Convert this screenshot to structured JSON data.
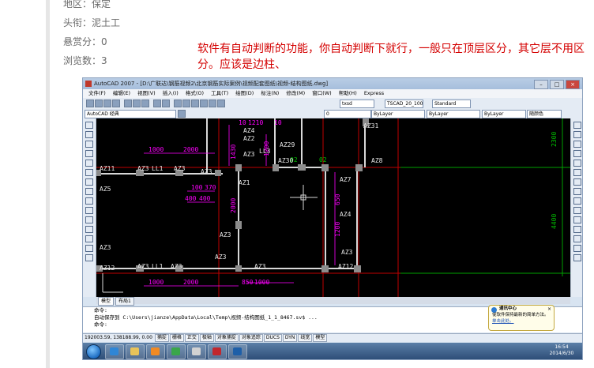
{
  "post": {
    "region": "地区：保定",
    "title_rank": "头衔：泥土工",
    "bounty": "悬赏分：0",
    "views": "浏览数：3"
  },
  "answer_text": "软件有自动判断的功能，你自动判断下就行，一般只在顶层区分，其它层不用区分。应该是边柱、",
  "autocad": {
    "window_title": "AutoCAD 2007 - [D:\\广联达\\钢筋视频2\\北京钢筋实际案例\\视频配套图纸\\视频-结构图纸.dwg]",
    "menu": [
      "文件(F)",
      "编辑(E)",
      "视图(V)",
      "插入(I)",
      "格式(O)",
      "工具(T)",
      "绘图(D)",
      "标注(N)",
      "修改(M)",
      "窗口(W)",
      "帮助(H)",
      "Express"
    ],
    "workspace": "AutoCAD 经典",
    "text_style": "txsd",
    "dim_style": "ISO-25",
    "table_style": "Standard",
    "dim_style2": "TSCAD_20_100",
    "layer": "0",
    "color": "ByLayer",
    "linetype": "ByLayer",
    "lineweight": "ByLayer",
    "plot_style": "随颜色",
    "drawing": {
      "labels": [
        "AZ11",
        "AZ3",
        "LL1",
        "AZ3",
        "AZ3",
        "AZ2",
        "AZ29",
        "AZ30",
        "AZ7",
        "AZ31",
        "AZ8",
        "AZ1",
        "AZ7",
        "AZ4",
        "AZ3",
        "AZ3",
        "AZ12",
        "AZ3",
        "LL1",
        "AZ3",
        "AZ12",
        "AZ4",
        "AZ3",
        "LL3",
        "AZ3",
        "AZ5",
        "AZ3",
        "AZ3"
      ],
      "dims_h": [
        "1000",
        "2000",
        "100",
        "370",
        "400",
        "400",
        "1000",
        "2000",
        "850",
        "1000",
        "10",
        "1210",
        "10",
        "2300",
        "4400",
        "02",
        "02"
      ],
      "dims_v": [
        "1200",
        "1200",
        "650",
        "1200",
        "2000",
        "1430",
        "1160",
        "850",
        "300",
        "1200",
        "1350",
        "110"
      ]
    },
    "tabs": [
      "模型",
      "布局1"
    ],
    "cmd_lines": [
      "命令:",
      "自动保存到 C:\\Users\\jianze\\AppData\\Local\\Temp\\视频-结构图纸_1_1_8467.sv$ ...",
      "命令:"
    ],
    "coords": "192003.59, 138188.99, 0.00",
    "status_buttons": [
      "捕捉",
      "栅格",
      "正交",
      "极轴",
      "对象捕捉",
      "对象追踪",
      "DUCS",
      "DYN",
      "线宽",
      "模型"
    ],
    "notify_title": "通讯中心",
    "notify_body": "使软件保持最新的简单方法。",
    "notify_link": "单击此处。",
    "clock_time": "16:54",
    "clock_date": "2014/6/30"
  },
  "colors": {
    "note_red": "#d40000",
    "cad_bg": "#000000",
    "dim_magenta": "#ff00ff",
    "axis_red": "#c00000",
    "axis_green": "#00a000",
    "wall_white": "#d8d8d8",
    "column_gray": "#8c8c8c"
  },
  "icons": [
    "autocad-logo-icon",
    "start-orb-icon",
    "ie-icon",
    "explorer-icon",
    "media-player-icon",
    "notify-info-icon",
    "close-icon"
  ]
}
